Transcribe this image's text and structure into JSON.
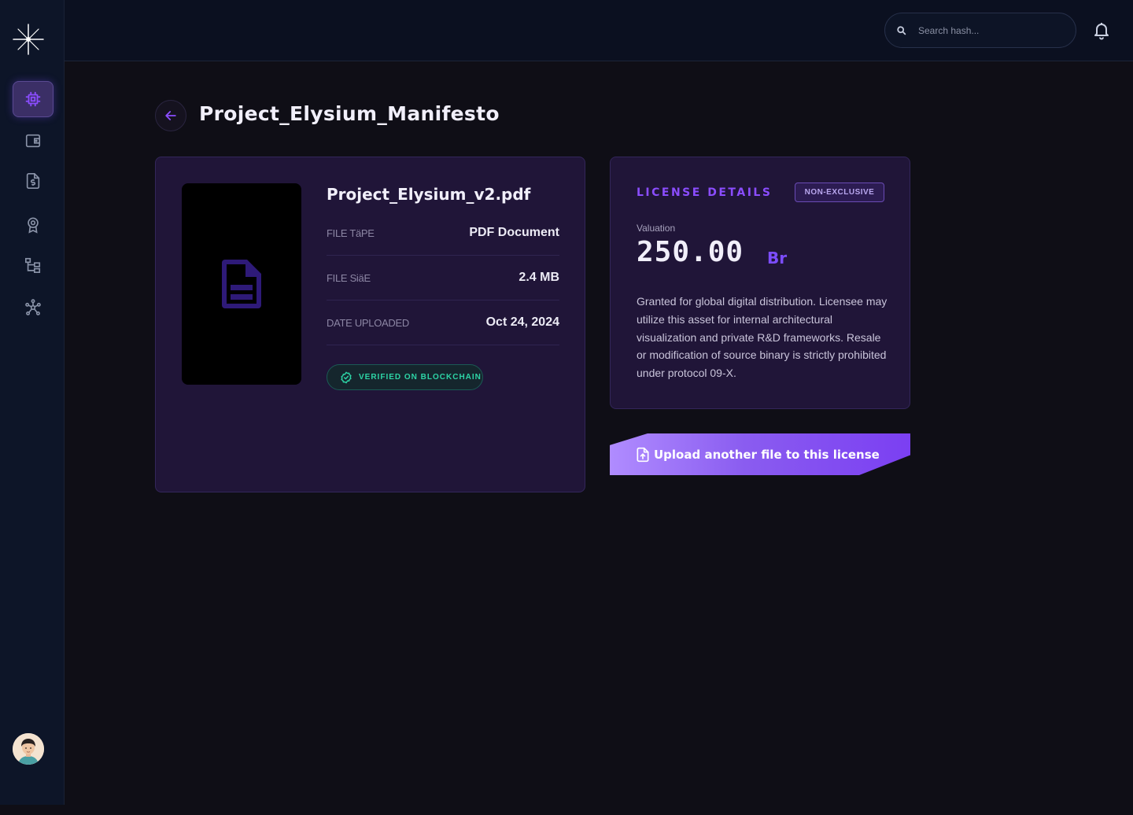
{
  "nav": {
    "items": [
      {
        "icon": "chip-icon",
        "active": true
      },
      {
        "icon": "wallet-icon",
        "active": false
      },
      {
        "icon": "invoice-icon",
        "active": false
      },
      {
        "icon": "award-icon",
        "active": false
      },
      {
        "icon": "hierarchy-icon",
        "active": false
      },
      {
        "icon": "network-icon",
        "active": false
      }
    ]
  },
  "topbar": {
    "search_placeholder": "Search hash..."
  },
  "page": {
    "title": "Project_Elysium_Manifesto"
  },
  "file": {
    "name": "Project_Elysium_v2.pdf",
    "type_label": "FILE TäPE",
    "type_value": "PDF Document",
    "size_label": "FILE SiäE",
    "size_value": "2.4 MB",
    "date_label": "DATE UPLOADED",
    "date_value": "Oct 24, 2024",
    "verified_label": "VERIFIED ON BLOCKCHAIN"
  },
  "license": {
    "title": "LICENSE DETAILS",
    "badge": "NON-EXCLUSIVE",
    "valuation_label": "Valuation",
    "valuation_amount": "250.00",
    "currency": "Br",
    "description": "Granted for global digital distribution. Licensee may utilize this asset for internal architectural visualization and private R&D frameworks. Resale or modification of source binary is strictly prohibited under protocol 09-X."
  },
  "actions": {
    "upload_label": "Upload another file to this license"
  },
  "colors": {
    "accent": "#7c4dff",
    "verified": "#2dd4a5",
    "card_bg": "#201538"
  }
}
